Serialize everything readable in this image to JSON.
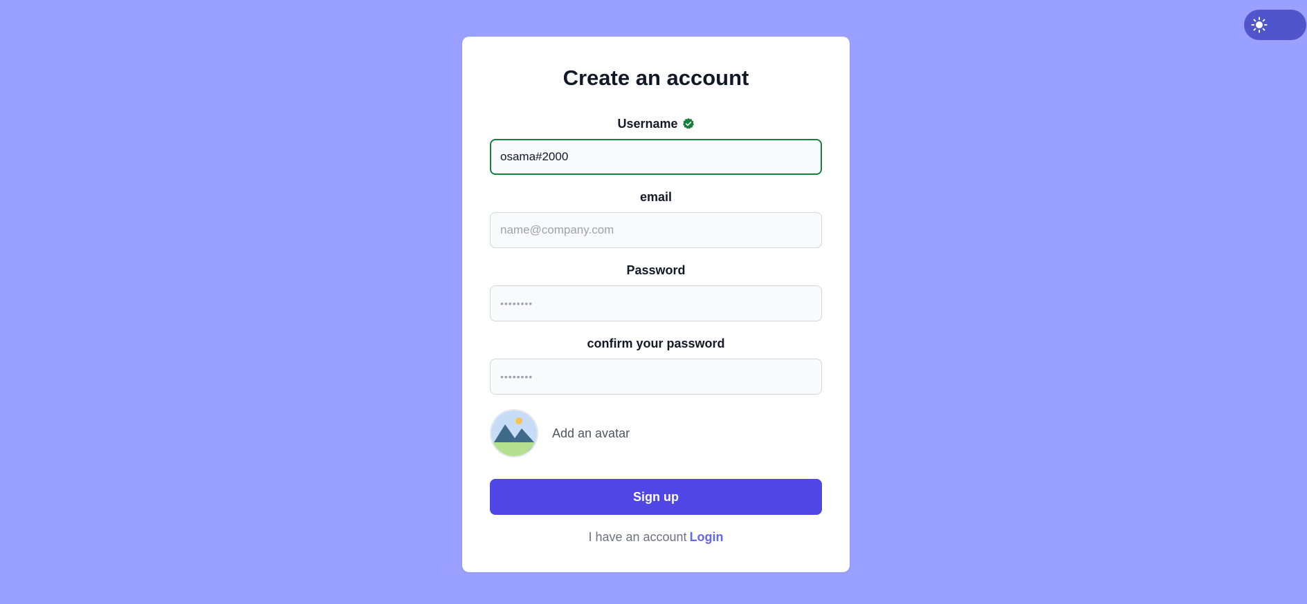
{
  "theme_toggle": {
    "icon": "sun-icon"
  },
  "form": {
    "title": "Create an account",
    "username": {
      "label": "Username",
      "value": "osama#2000",
      "status_icon": "verified-check-icon",
      "status_color": "#15803d"
    },
    "email": {
      "label": "email",
      "placeholder": "name@company.com",
      "value": ""
    },
    "password": {
      "label": "Password",
      "placeholder": "••••••••",
      "value": ""
    },
    "confirm_password": {
      "label": "confirm your password",
      "placeholder": "••••••••",
      "value": ""
    },
    "avatar": {
      "icon": "image-placeholder-icon",
      "label": "Add an avatar"
    },
    "submit_label": "Sign up",
    "footer": {
      "text": "I have an account",
      "link_label": "Login"
    }
  },
  "colors": {
    "background": "#9aa0ff",
    "accent": "#4f46e5",
    "link": "#6366f1",
    "toggle": "#5155cc"
  }
}
